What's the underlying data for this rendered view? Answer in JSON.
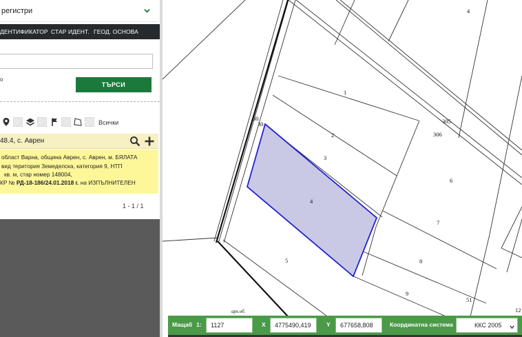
{
  "registry": {
    "selected": "регистри"
  },
  "tabs": [
    {
      "label": "ДЕНТИФИКАТОР"
    },
    {
      "label": "СТАР ИДЕНТ."
    },
    {
      "label": "ГЕОД. ОСНОВА"
    }
  ],
  "search": {
    "value": "",
    "placeholder": "",
    "hint": "о",
    "button_label": "ТЪРСИ"
  },
  "filters": {
    "icons": [
      "map-pin-icon",
      "layers-icon",
      "flag-icon",
      "polygon-icon"
    ],
    "all_label": "Всички"
  },
  "result": {
    "title": "48.4, с. Аврен",
    "lines": [
      "област Варна, община Аврен, с. Аврен, м. БЯЛАТА",
      "вид територия Земеделска, категория 9, НТП",
      "кв. м, стар номер 148004,"
    ],
    "line4_prefix": "КР № ",
    "line4_bold": "РД-18-186/24.01.2018 г.",
    "line4_suffix": " на ИЗПЪЛНИТЕЛЕН"
  },
  "pager": {
    "text": "1 - 1 / 1"
  },
  "map": {
    "parcel_labels": [
      "4",
      "1",
      "2",
      "3",
      "4",
      "5",
      "6",
      "7",
      "8",
      "9",
      "30",
      "30",
      "305",
      "306",
      "51",
      "12"
    ],
    "annotation": "арх.об.",
    "highlight_fill": "#c9c9e6",
    "highlight_stroke": "#2222cc"
  },
  "bottombar": {
    "scale_label": "Мащаб",
    "scale_prefix": "1:",
    "scale_value": "1127",
    "x_label": "X",
    "x_value": "4775490,419",
    "y_label": "Y",
    "y_value": "677658,808",
    "coord_label": "Координатна система",
    "coord_value": "ККС 2005"
  },
  "colors": {
    "search_button": "#1b7a3b",
    "tab_bar": "#252a2e",
    "result_header": "#f6f0c2",
    "result_body": "#fdf79a",
    "bottom_bar": "#4a9a48",
    "panel_bg": "#5a5a5a"
  }
}
